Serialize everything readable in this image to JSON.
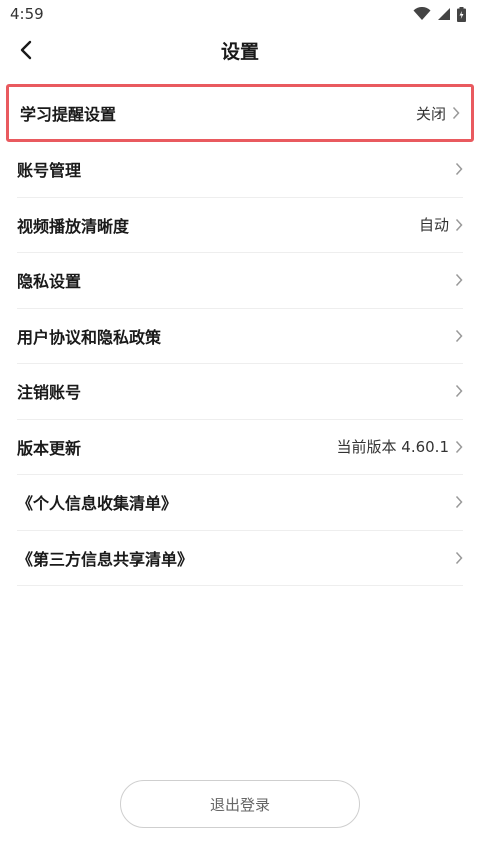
{
  "status_bar": {
    "time": "4:59"
  },
  "header": {
    "title": "设置"
  },
  "settings": [
    {
      "label": "学习提醒设置",
      "value": "关闭"
    },
    {
      "label": "账号管理",
      "value": ""
    },
    {
      "label": "视频播放清晰度",
      "value": "自动"
    },
    {
      "label": "隐私设置",
      "value": ""
    },
    {
      "label": "用户协议和隐私政策",
      "value": ""
    },
    {
      "label": "注销账号",
      "value": ""
    },
    {
      "label": "版本更新",
      "value": "当前版本 4.60.1"
    },
    {
      "label": "《个人信息收集清单》",
      "value": ""
    },
    {
      "label": "《第三方信息共享清单》",
      "value": ""
    }
  ],
  "logout_label": "退出登录",
  "colors": {
    "highlight_border": "#e95a5f",
    "divider": "#eeeeee"
  }
}
